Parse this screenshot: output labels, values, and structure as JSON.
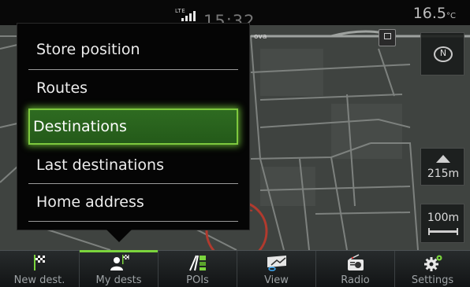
{
  "status": {
    "network": "LTE",
    "clock": "15:32",
    "temperature": "16.5",
    "temperature_unit": "°C"
  },
  "map": {
    "road_label": "ova",
    "altitude": "215m",
    "scale": "100m",
    "icons": [
      "compass-north-icon",
      "fuel-station-icon",
      "altitude-mountain-icon",
      "vehicle-position-icon"
    ]
  },
  "menu": {
    "items": [
      {
        "label": "Store position"
      },
      {
        "label": "Routes"
      },
      {
        "label": "Destinations",
        "selected": true
      },
      {
        "label": "Last destinations"
      },
      {
        "label": "Home address"
      }
    ]
  },
  "navbar": {
    "tabs": [
      {
        "label": "New dest.",
        "icon": "checkered-flag-icon"
      },
      {
        "label": "My dests",
        "icon": "person-flag-icon",
        "active": true
      },
      {
        "label": "POIs",
        "icon": "poi-icon"
      },
      {
        "label": "View",
        "icon": "map-view-icon"
      },
      {
        "label": "Radio",
        "icon": "radio-icon"
      },
      {
        "label": "Settings",
        "icon": "gear-icon"
      }
    ]
  },
  "colors": {
    "accent": "#7bd43d",
    "selected_bg": "#2e6b21",
    "map_bg": "#3f4340",
    "route": "#c0392b"
  }
}
